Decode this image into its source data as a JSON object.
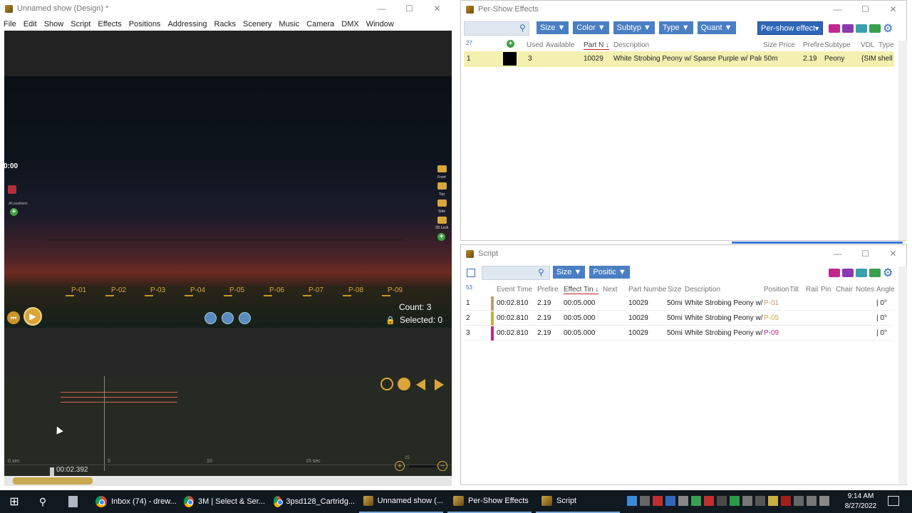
{
  "design": {
    "title": "Unnamed show (Design) *",
    "menu": [
      "File",
      "Edit",
      "Show",
      "Script",
      "Effects",
      "Positions",
      "Addressing",
      "Racks",
      "Scenery",
      "Music",
      "Camera",
      "DMX",
      "Window"
    ],
    "time_display": "0:00",
    "all_positions_label": "All positions",
    "positions": [
      "P-01",
      "P-02",
      "P-03",
      "P-04",
      "P-05",
      "P-06",
      "P-07",
      "P-08",
      "P-09"
    ],
    "camera_labels": [
      "Front",
      "Top",
      "Side",
      "2D Lock"
    ],
    "count_label": "Count: 3",
    "selected_label": "Selected: 0",
    "timeline": {
      "ticks": [
        "0 sec",
        "5",
        "10",
        "15 sec"
      ],
      "current_time": "00:02.392",
      "zoom_value": "25"
    }
  },
  "per_show": {
    "title": "Per-Show Effects",
    "filters": [
      "Size",
      "Color",
      "Subtyp",
      "Type",
      "Quant"
    ],
    "mode_select": "Per-show effect",
    "count": "27",
    "columns": [
      "Used",
      "Available",
      "Part N",
      "Description",
      "Size",
      "Price",
      "Prefire",
      "Subtype",
      "VDL",
      "Type"
    ],
    "rows": [
      {
        "num": "1",
        "used": "3",
        "available": "",
        "part": "10029",
        "description": "White Strobing Peony w/ Sparse Purple w/ Palm",
        "size": "50m",
        "price": "",
        "prefire": "2.19",
        "subtype": "Peony",
        "vdl": "{SIM",
        "type": "shell"
      }
    ]
  },
  "script": {
    "title": "Script",
    "filters": [
      "Size",
      "Positic"
    ],
    "count": "53",
    "columns": [
      "Event Time",
      "Prefire",
      "Effect Tin",
      "Next",
      "Part Numbe",
      "Size",
      "Description",
      "Position",
      "Tilt",
      "Rail",
      "Pin",
      "Chair",
      "Notes",
      "Angle"
    ],
    "rows": [
      {
        "num": "1",
        "color": "#b8a070",
        "event_time": "00:02.810",
        "prefire": "2.19",
        "effect_time": "00:05.000",
        "part": "10029",
        "size": "50mi",
        "description": "White Strobing Peony w/",
        "position": "P-01",
        "pos_color": "#c8a070",
        "angle": "| 0°"
      },
      {
        "num": "2",
        "color": "#c8b040",
        "event_time": "00:02.810",
        "prefire": "2.19",
        "effect_time": "00:05.000",
        "part": "10029",
        "size": "50mi",
        "description": "White Strobing Peony w/",
        "position": "P-05",
        "pos_color": "#c8b040",
        "angle": "| 0°"
      },
      {
        "num": "3",
        "color": "#c02890",
        "event_time": "00:02.810",
        "prefire": "2.19",
        "effect_time": "00:05.000",
        "part": "10029",
        "size": "50mi",
        "description": "White Strobing Peony w/",
        "position": "P-09",
        "pos_color": "#c02890",
        "angle": "| 0°"
      }
    ]
  },
  "taskbar": {
    "items": [
      "Inbox (74) - drew...",
      "3M | Select & Ser...",
      "3psd128_Cartridg...",
      "Unnamed show (...",
      "Per-Show Effects",
      "Script"
    ],
    "time": "9:14 AM",
    "date": "8/27/2022"
  }
}
